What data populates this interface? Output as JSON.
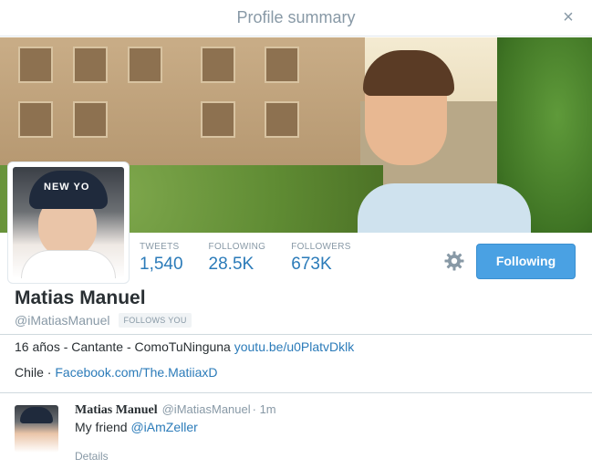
{
  "modal": {
    "title": "Profile summary",
    "close_glyph": "×"
  },
  "avatar": {
    "cap_text": "NEW YO"
  },
  "stats": [
    {
      "label": "TWEETS",
      "value": "1,540"
    },
    {
      "label": "FOLLOWING",
      "value": "28.5K"
    },
    {
      "label": "FOLLOWERS",
      "value": "673K"
    }
  ],
  "actions": {
    "settings_icon": "gear-icon",
    "follow_label": "Following"
  },
  "profile": {
    "name": "Matias Manuel",
    "handle": "@iMatiasManuel",
    "follows_you": "FOLLOWS YOU",
    "bio_text": "16 años - Cantante - ComoTuNinguna ",
    "bio_link": "youtu.be/u0PlatvDklk",
    "location": "Chile",
    "location_sep": " · ",
    "website": "Facebook.com/The.MatiiaxD"
  },
  "tweet": {
    "name": "Matias Manuel",
    "handle": "@iMatiasManuel",
    "time": "· 1m",
    "text": "My friend ",
    "mention": "@iAmZeller",
    "details_label": "Details"
  },
  "colors": {
    "accent": "#2b7bb9",
    "button": "#4aa1e3",
    "muted": "#8899a6"
  }
}
